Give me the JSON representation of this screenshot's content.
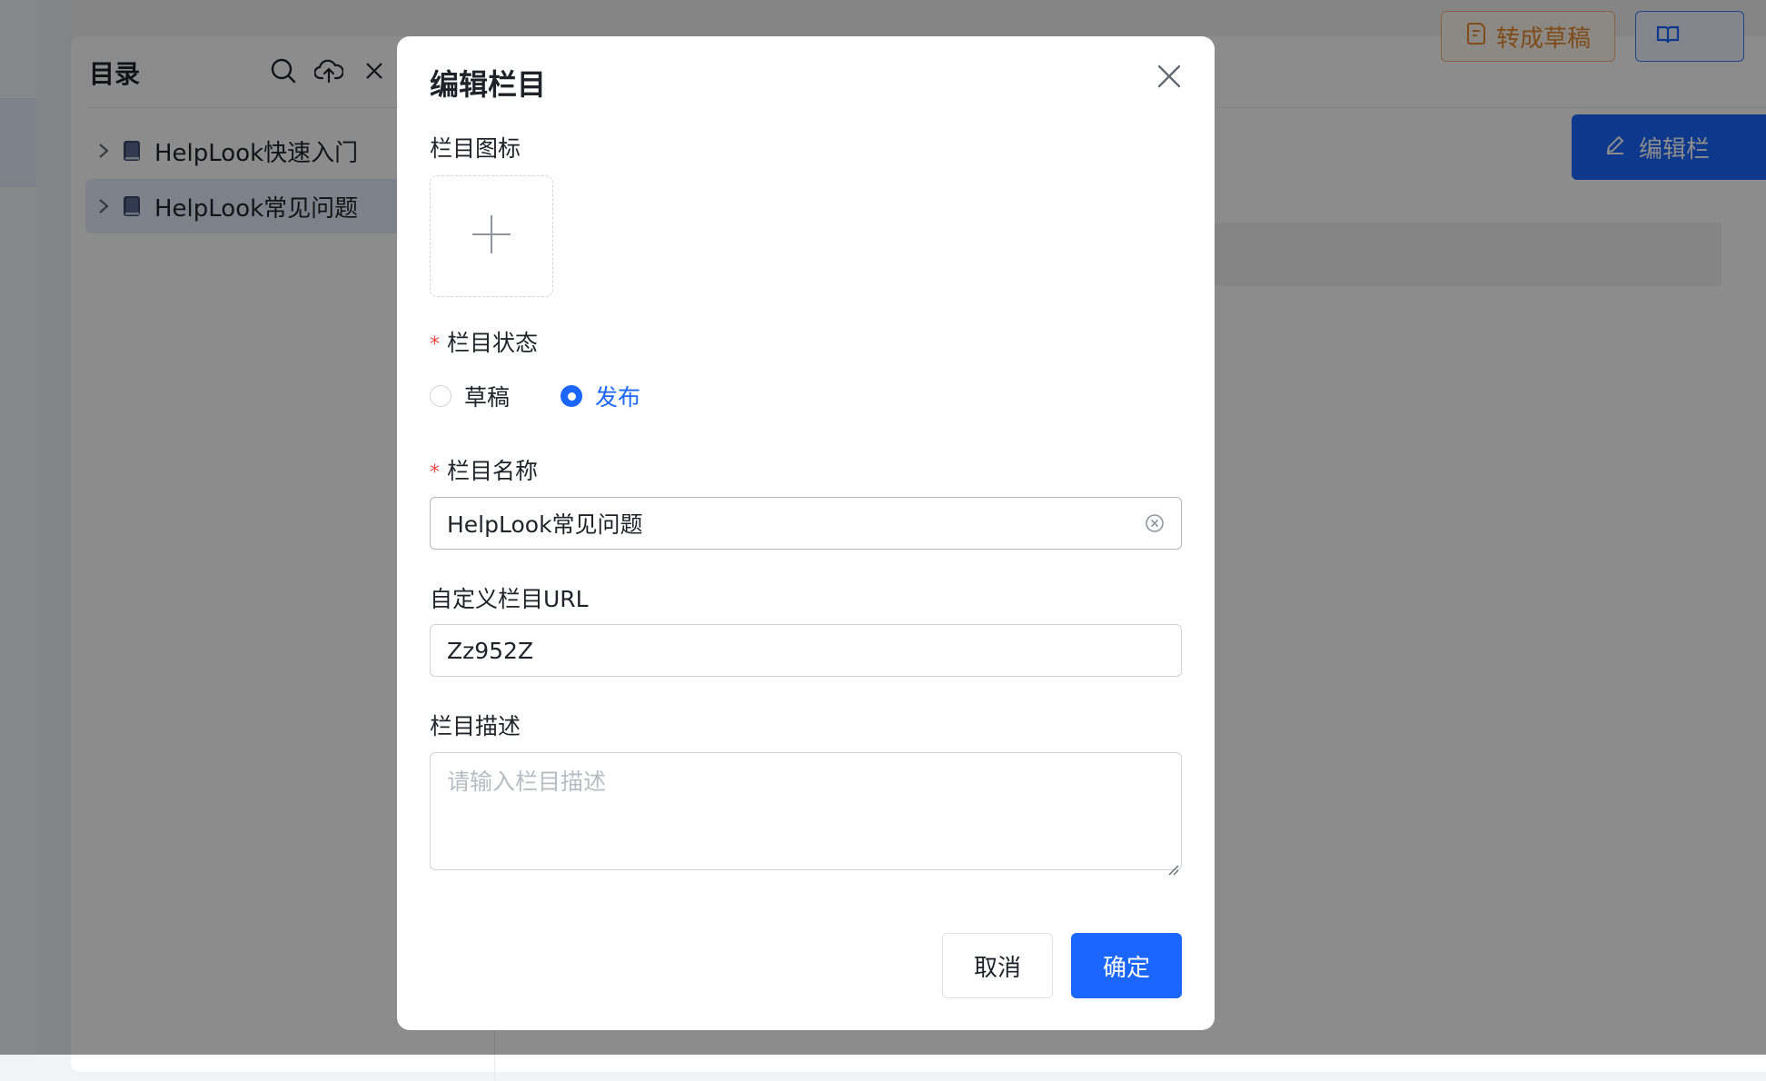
{
  "background": {
    "toc_title": "目录",
    "toc_items": [
      {
        "label": "HelpLook快速入门"
      },
      {
        "label": "HelpLook常见问题"
      }
    ],
    "draft_button": "转成草稿",
    "edit_button": "编辑栏",
    "accent_color": "#1a66ff"
  },
  "modal": {
    "title": "编辑栏目",
    "icon_label": "栏目图标",
    "status_label": "栏目状态",
    "status_options": [
      {
        "label": "草稿",
        "checked": false
      },
      {
        "label": "发布",
        "checked": true
      }
    ],
    "name_label": "栏目名称",
    "name_value": "HelpLook常见问题",
    "url_label": "自定义栏目URL",
    "url_value": "Zz952Z",
    "desc_label": "栏目描述",
    "desc_placeholder": "请输入栏目描述",
    "cancel": "取消",
    "ok": "确定"
  }
}
